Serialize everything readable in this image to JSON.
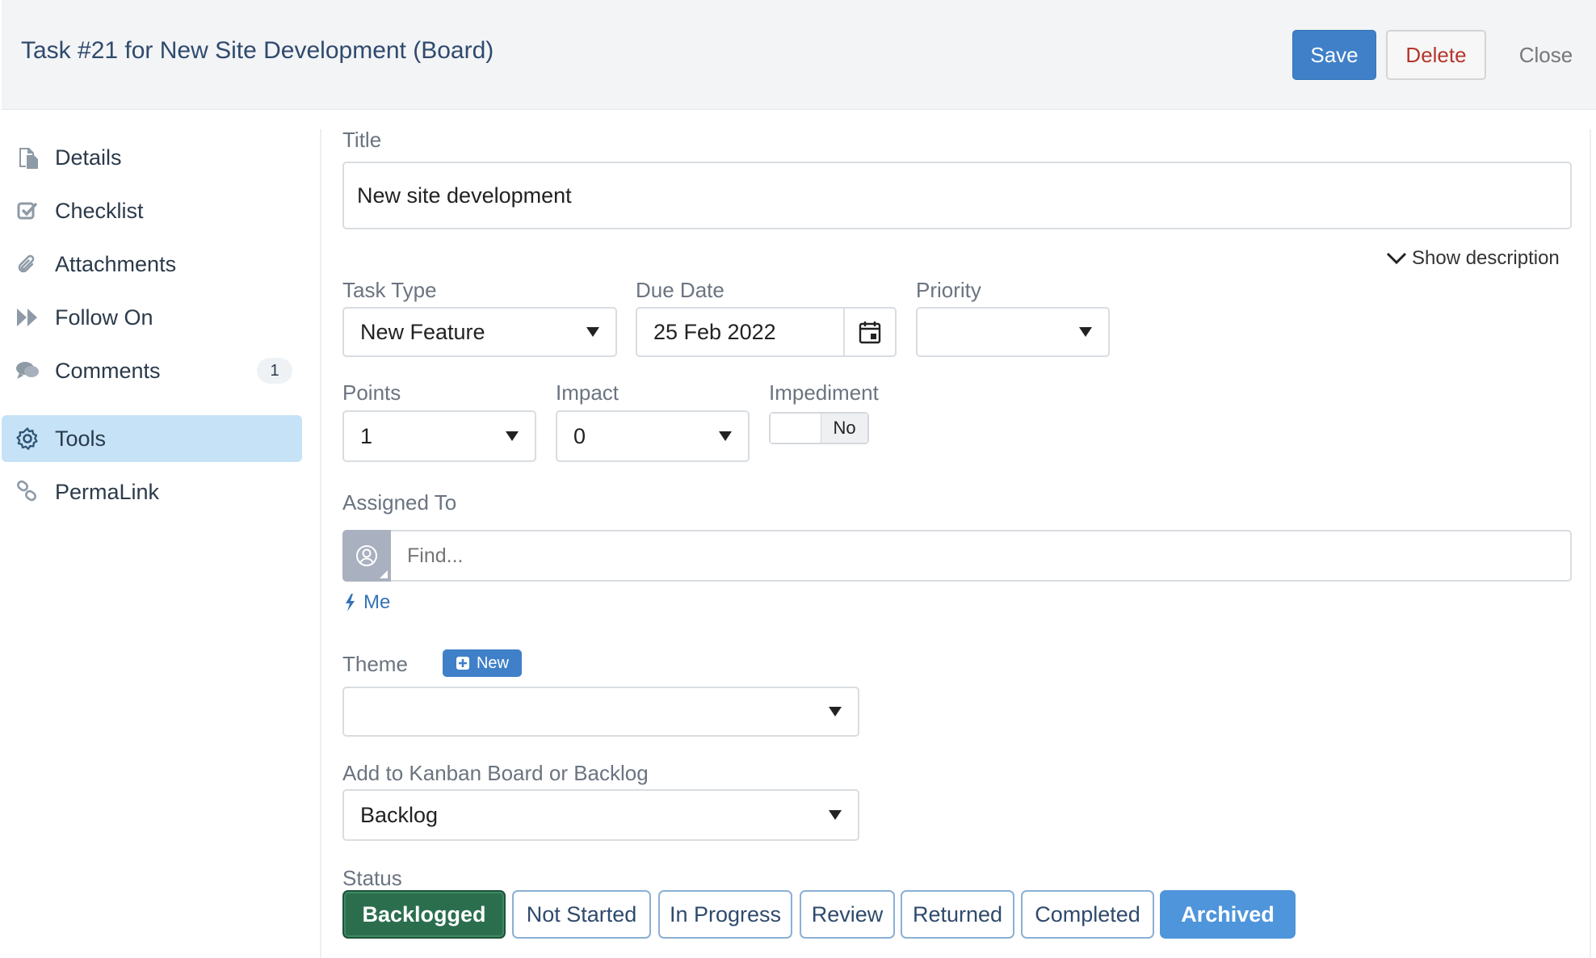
{
  "header": {
    "title": "Task #21 for New Site Development (Board)",
    "save_label": "Save",
    "delete_label": "Delete",
    "close_label": "Close"
  },
  "sidebar": {
    "items": [
      {
        "label": "Details",
        "icon": "document-icon"
      },
      {
        "label": "Checklist",
        "icon": "checkbox-icon"
      },
      {
        "label": "Attachments",
        "icon": "paperclip-icon"
      },
      {
        "label": "Follow On",
        "icon": "fast-forward-icon"
      },
      {
        "label": "Comments",
        "icon": "chat-icon",
        "badge": "1"
      },
      {
        "label": "Tools",
        "icon": "gear-icon",
        "active": true
      },
      {
        "label": "PermaLink",
        "icon": "link-icon"
      }
    ]
  },
  "form": {
    "title_label": "Title",
    "title_value": "New site development",
    "show_description": "Show description",
    "task_type_label": "Task Type",
    "task_type_value": "New Feature",
    "due_date_label": "Due Date",
    "due_date_value": "25 Feb 2022",
    "priority_label": "Priority",
    "priority_value": "",
    "points_label": "Points",
    "points_value": "1",
    "impact_label": "Impact",
    "impact_value": "0",
    "impediment_label": "Impediment",
    "impediment_value": "No",
    "assigned_label": "Assigned To",
    "assigned_placeholder": "Find...",
    "me_label": "Me",
    "theme_label": "Theme",
    "theme_new_label": "New",
    "theme_value": "",
    "board_label": "Add to Kanban Board or Backlog",
    "board_value": "Backlog",
    "status_label": "Status",
    "statuses": [
      "Backlogged",
      "Not Started",
      "In Progress",
      "Review",
      "Returned",
      "Completed",
      "Archived"
    ],
    "status_selected": "Backlogged"
  },
  "colors": {
    "primary": "#3f80c8",
    "danger": "#b5362d",
    "active_status": "#2b6e4e",
    "sidebar_active": "#c6e2f6"
  }
}
